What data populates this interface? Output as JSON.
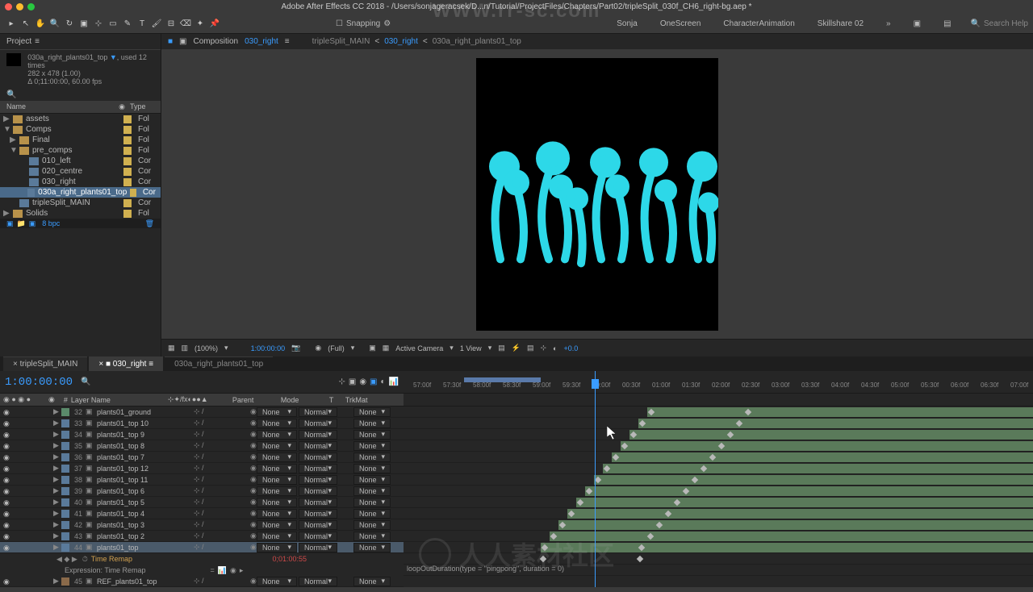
{
  "app": {
    "title": "Adobe After Effects CC 2018 - /Users/sonjageracsek/D...n/Tutorial/ProjectFiles/Chapters/Part02/tripleSplit_030f_CH6_right-bg.aep *",
    "watermark": "WWW.rr-sc.com",
    "watermark_cn": "人人素材社区"
  },
  "toolbar": {
    "snapping": "Snapping",
    "workspaces": [
      "Sonja",
      "OneScreen",
      "CharacterAnimation",
      "Skillshare 02"
    ],
    "search_help": "Search Help"
  },
  "project": {
    "panel_title": "Project",
    "selected_name": "030a_right_plants01_top",
    "selected_used": ", used 12 times",
    "selected_dims": "282 x 478 (1.00)",
    "selected_duration": "Δ 0;11:00:00, 60.00 fps",
    "col_name": "Name",
    "col_type": "Type",
    "tree": [
      {
        "level": 0,
        "arrow": "▶",
        "icon": "folder",
        "name": "assets",
        "type": "Fol"
      },
      {
        "level": 0,
        "arrow": "▼",
        "icon": "folder",
        "name": "Comps",
        "type": "Fol"
      },
      {
        "level": 1,
        "arrow": "▶",
        "icon": "folder",
        "name": "Final",
        "type": "Fol"
      },
      {
        "level": 1,
        "arrow": "▼",
        "icon": "folder",
        "name": "pre_comps",
        "type": "Fol"
      },
      {
        "level": 2,
        "arrow": "",
        "icon": "comp",
        "name": "010_left",
        "type": "Cor"
      },
      {
        "level": 2,
        "arrow": "",
        "icon": "comp",
        "name": "020_centre",
        "type": "Cor"
      },
      {
        "level": 2,
        "arrow": "",
        "icon": "comp",
        "name": "030_right",
        "type": "Cor"
      },
      {
        "level": 2,
        "arrow": "",
        "icon": "comp",
        "name": "030a_right_plants01_top",
        "type": "Cor",
        "selected": true
      },
      {
        "level": 1,
        "arrow": "",
        "icon": "comp",
        "name": "tripleSplit_MAIN",
        "type": "Cor"
      },
      {
        "level": 0,
        "arrow": "▶",
        "icon": "folder",
        "name": "Solids",
        "type": "Fol"
      }
    ],
    "bpc": "8 bpc"
  },
  "composition": {
    "header": "Composition",
    "header_name": "030_right",
    "breadcrumb": [
      "tripleSplit_MAIN",
      "030_right",
      "030a_right_plants01_top"
    ],
    "active_crumb_index": 1
  },
  "viewer": {
    "zoom": "(100%)",
    "timecode": "1:00:00:00",
    "resolution": "(Full)",
    "camera": "Active Camera",
    "views": "1 View",
    "exposure": "+0.0"
  },
  "timeline": {
    "tabs": [
      "tripleSplit_MAIN",
      "030_right",
      "030a_right_plants01_top"
    ],
    "active_tab_index": 1,
    "timecode": "1:00:00:00",
    "col_layer_name": "Layer Name",
    "col_parent": "Parent",
    "col_mode": "Mode",
    "col_t": "T",
    "col_trkmat": "TrkMat",
    "ruler_ticks": [
      "57:00f",
      "57:30f",
      "58:00f",
      "58:30f",
      "59:00f",
      "59:30f",
      "00:00f",
      "00:30f",
      "01:00f",
      "01:30f",
      "02:00f",
      "02:30f",
      "03:00f",
      "03:30f",
      "04:00f",
      "04:30f",
      "05:00f",
      "05:30f",
      "06:00f",
      "06:30f",
      "07:00f"
    ],
    "layers": [
      {
        "num": 32,
        "name": "plants01_ground",
        "swatch": "green",
        "parent": "None",
        "mode": "Normal",
        "trk": "None"
      },
      {
        "num": 33,
        "name": "plants01_top 10",
        "swatch": "blue",
        "parent": "None",
        "mode": "Normal",
        "trk": "None"
      },
      {
        "num": 34,
        "name": "plants01_top 9",
        "swatch": "blue",
        "parent": "None",
        "mode": "Normal",
        "trk": "None"
      },
      {
        "num": 35,
        "name": "plants01_top 8",
        "swatch": "blue",
        "parent": "None",
        "mode": "Normal",
        "trk": "None"
      },
      {
        "num": 36,
        "name": "plants01_top 7",
        "swatch": "blue",
        "parent": "None",
        "mode": "Normal",
        "trk": "None"
      },
      {
        "num": 37,
        "name": "plants01_top 12",
        "swatch": "blue",
        "parent": "None",
        "mode": "Normal",
        "trk": "None"
      },
      {
        "num": 38,
        "name": "plants01_top 11",
        "swatch": "blue",
        "parent": "None",
        "mode": "Normal",
        "trk": "None"
      },
      {
        "num": 39,
        "name": "plants01_top 6",
        "swatch": "blue",
        "parent": "None",
        "mode": "Normal",
        "trk": "None"
      },
      {
        "num": 40,
        "name": "plants01_top 5",
        "swatch": "blue",
        "parent": "None",
        "mode": "Normal",
        "trk": "None"
      },
      {
        "num": 41,
        "name": "plants01_top 4",
        "swatch": "blue",
        "parent": "None",
        "mode": "Normal",
        "trk": "None"
      },
      {
        "num": 42,
        "name": "plants01_top 3",
        "swatch": "blue",
        "parent": "None",
        "mode": "Normal",
        "trk": "None"
      },
      {
        "num": 43,
        "name": "plants01_top 2",
        "swatch": "blue",
        "parent": "None",
        "mode": "Normal",
        "trk": "None"
      },
      {
        "num": 44,
        "name": "plants01_top",
        "swatch": "blue",
        "parent": "None",
        "mode": "Normal",
        "trk": "None",
        "selected": true
      }
    ],
    "time_remap": {
      "name": "Time Remap",
      "value": "0;01:00:55",
      "expr_label": "Expression: Time Remap",
      "expression": "loopOutDuration(type = \"pingpong\", duration = 0)"
    },
    "ref_layer": {
      "num": 45,
      "name": "REF_plants01_top",
      "swatch": "brown",
      "parent": "None",
      "mode": "Normal",
      "trk": "None"
    },
    "opt_none": "None",
    "opt_normal": "Normal"
  }
}
